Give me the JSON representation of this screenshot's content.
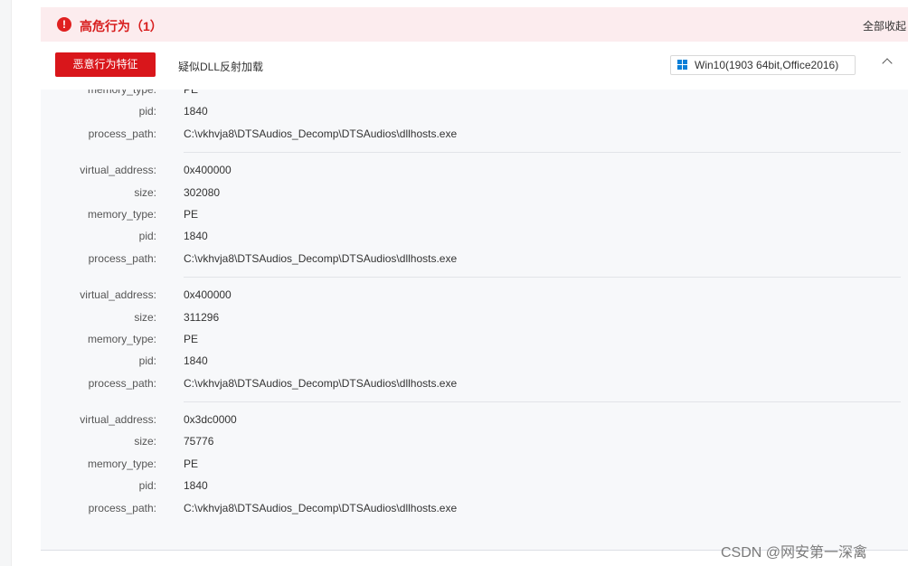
{
  "alert": {
    "icon": "exclamation-icon",
    "title": "高危行为（1）",
    "collapse_all": "全部收起"
  },
  "behavior": {
    "tag_label": "恶意行为特征",
    "name": "疑似DLL反射加载",
    "env_label": "Win10(1903 64bit,Office2016)",
    "env_icon": "windows-icon",
    "collapse_icon": "chevron-up-icon"
  },
  "records": [
    {
      "fields": [
        {
          "key": "memory_type:",
          "value": "PE"
        },
        {
          "key": "pid:",
          "value": "1840"
        },
        {
          "key": "process_path:",
          "value": "C:\\vkhvja8\\DTSAudios_Decomp\\DTSAudios\\dllhosts.exe"
        }
      ]
    },
    {
      "fields": [
        {
          "key": "virtual_address:",
          "value": "0x400000"
        },
        {
          "key": "size:",
          "value": "302080"
        },
        {
          "key": "memory_type:",
          "value": "PE"
        },
        {
          "key": "pid:",
          "value": "1840"
        },
        {
          "key": "process_path:",
          "value": "C:\\vkhvja8\\DTSAudios_Decomp\\DTSAudios\\dllhosts.exe"
        }
      ]
    },
    {
      "fields": [
        {
          "key": "virtual_address:",
          "value": "0x400000"
        },
        {
          "key": "size:",
          "value": "311296"
        },
        {
          "key": "memory_type:",
          "value": "PE"
        },
        {
          "key": "pid:",
          "value": "1840"
        },
        {
          "key": "process_path:",
          "value": "C:\\vkhvja8\\DTSAudios_Decomp\\DTSAudios\\dllhosts.exe"
        }
      ]
    },
    {
      "fields": [
        {
          "key": "virtual_address:",
          "value": "0x3dc0000"
        },
        {
          "key": "size:",
          "value": "75776"
        },
        {
          "key": "memory_type:",
          "value": "PE"
        },
        {
          "key": "pid:",
          "value": "1840"
        },
        {
          "key": "process_path:",
          "value": "C:\\vkhvja8\\DTSAudios_Decomp\\DTSAudios\\dllhosts.exe"
        }
      ]
    }
  ],
  "watermark": "CSDN @网安第一深禽",
  "colors": {
    "danger": "#d9161b",
    "alert_bg": "#fcecee",
    "panel_bg": "#f7f8fa",
    "windows_blue": "#0a7fd8"
  }
}
